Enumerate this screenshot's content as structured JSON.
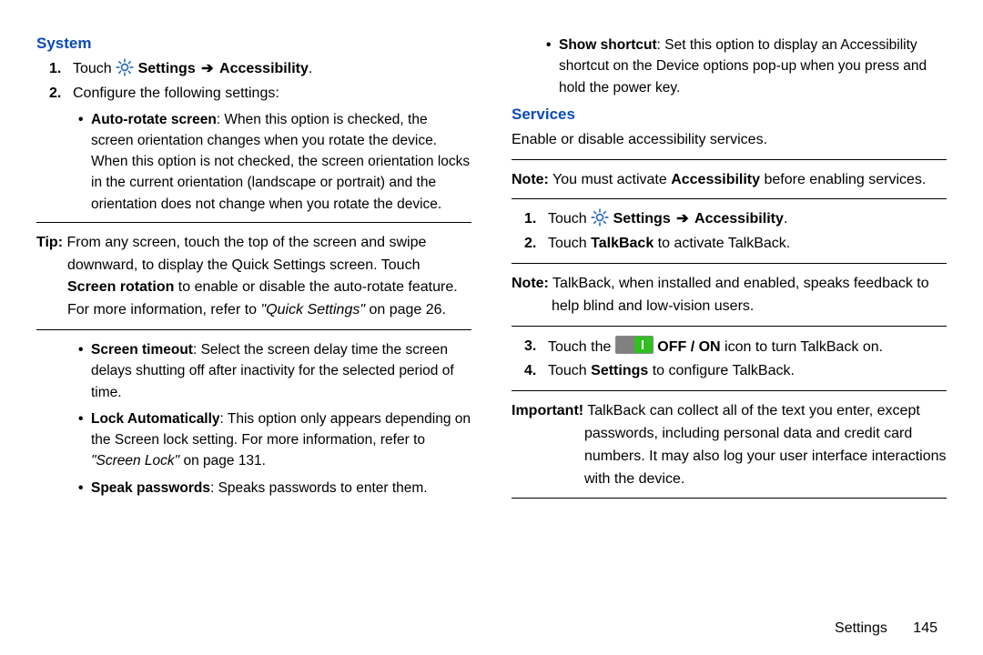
{
  "left": {
    "heading": "System",
    "steps": [
      {
        "num": "1.",
        "pre": "Touch ",
        "strong": "Settings",
        "arrow": "➔",
        "strong2": "Accessibility",
        "post": "."
      },
      {
        "num": "2.",
        "text": "Configure the following settings:"
      }
    ],
    "bullet1": {
      "label": "Auto-rotate screen",
      "text": ": When this option is checked, the screen orientation changes when you rotate the device. When this option is not checked, the screen orientation locks in the current orientation (landscape or portrait) and the orientation does not change when you rotate the device."
    },
    "tip": {
      "label": "Tip:",
      "part1": " From any screen, touch the top of the screen and swipe downward, to display the Quick Settings screen. Touch ",
      "strong": "Screen rotation",
      "part2": " to enable or disable the auto-rotate feature. For more information, refer to ",
      "ref": "\"Quick Settings\"",
      "part3": " on page 26."
    },
    "bullets2": [
      {
        "label": "Screen timeout",
        "text": ": Select the screen delay time the screen delays shutting off after inactivity for the selected period of time."
      },
      {
        "label": "Lock Automatically",
        "text": ": This option only appears depending on the Screen lock setting. For more information, refer to ",
        "ref": "\"Screen Lock\"",
        "tail": " on page 131."
      },
      {
        "label": "Speak passwords",
        "text": ": Speaks passwords to enter them."
      }
    ]
  },
  "right": {
    "top_bullet": {
      "label": "Show shortcut",
      "text": ": Set this option to display an Accessibility shortcut on the Device options pop-up when you press and hold the power key."
    },
    "heading": "Services",
    "intro": "Enable or disable accessibility services.",
    "note1": {
      "label": "Note:",
      "pre": " You must activate ",
      "strong": "Accessibility",
      "post": " before enabling services."
    },
    "steps1": [
      {
        "num": "1.",
        "pre": "Touch ",
        "strong": "Settings",
        "arrow": "➔",
        "strong2": "Accessibility",
        "post": "."
      },
      {
        "num": "2.",
        "pre": "Touch ",
        "strong": "TalkBack",
        "post": " to activate TalkBack."
      }
    ],
    "note2": {
      "label": "Note:",
      "text": " TalkBack, when installed and enabled, speaks feedback to help blind and low-vision users."
    },
    "steps2": [
      {
        "num": "3.",
        "pre": "Touch the ",
        "strong": "OFF / ON",
        "post": " icon to turn TalkBack on."
      },
      {
        "num": "4.",
        "pre": "Touch ",
        "strong": "Settings",
        "post": " to configure TalkBack."
      }
    ],
    "important": {
      "label": "Important!",
      "text": " TalkBack can collect all of the text you enter, except passwords, including personal data and credit card numbers. It may also log your user interface interactions with the device."
    }
  },
  "footer": {
    "section": "Settings",
    "page": "145"
  }
}
